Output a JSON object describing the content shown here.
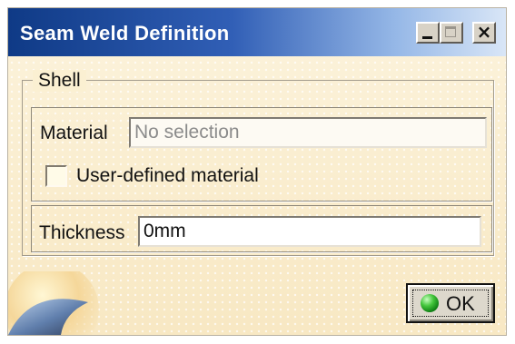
{
  "window": {
    "title": "Seam Weld Definition",
    "controls": {
      "minimize_icon": "minimize-icon",
      "maximize_icon": "maximize-icon",
      "close_icon": "close-icon"
    }
  },
  "shell": {
    "group_label": "Shell",
    "material_label": "Material",
    "material_placeholder": "No selection",
    "checkbox_label": "User-defined material",
    "thickness_label": "Thickness",
    "thickness_value": "0mm"
  },
  "actions": {
    "ok_label": "OK",
    "ok_icon": "green-circle-icon"
  },
  "colors": {
    "title_start": "#0f3a86",
    "title_end": "#d9e6f7",
    "panel": "#fbf0d2",
    "ok_icon": "#43c53b"
  }
}
